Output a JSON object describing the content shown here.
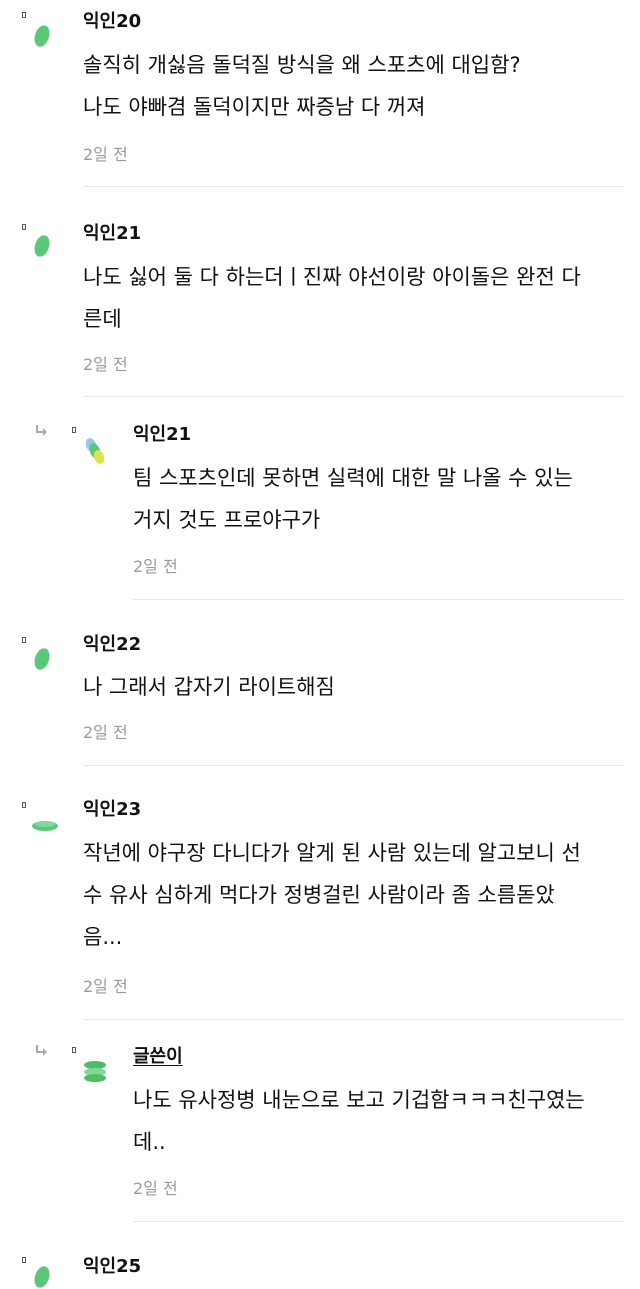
{
  "comments": [
    {
      "author": "익인20",
      "lines": [
        "솔직히 개싫음 돌덕질 방식을 왜 스포츠에 대입함?",
        "나도 야빠겸 돌덕이지만 짜증남 다 꺼져"
      ],
      "time": "2일 전",
      "reply": false,
      "avatar_color": "#5ac779"
    },
    {
      "author": "익인21",
      "lines": [
        "나도 싫어 둘 다 하는더ㅣ진짜 야선이랑 아이돌은 완전 다",
        "른데"
      ],
      "time": "2일 전",
      "reply": false,
      "avatar_color": "#5ac779"
    },
    {
      "author": "익인21",
      "lines": [
        "팀 스포츠인데 못하면 실력에 대한 말 나올 수 있는",
        "거지 것도 프로야구가"
      ],
      "time": "2일 전",
      "reply": true,
      "avatar_color": "#b8d94d"
    },
    {
      "author": "익인22",
      "lines": [
        "나 그래서 갑자기 라이트해짐"
      ],
      "time": "2일 전",
      "reply": false,
      "avatar_color": "#5ac779"
    },
    {
      "author": "익인23",
      "lines": [
        "작년에 야구장 다니다가 알게 된 사람 있는데 알고보니 선",
        "수 유사 심하게 먹다가 정병걸린 사람이라 좀 소름돋았",
        "음..."
      ],
      "time": "2일 전",
      "reply": false,
      "avatar_color": "#5ac779"
    },
    {
      "author": "글쓴이",
      "lines": [
        "나도 유사정병 내눈으로 보고 기겁함ㅋㅋㅋ친구였는",
        "데.."
      ],
      "time": "2일 전",
      "reply": true,
      "avatar_color": "#4cbf63"
    },
    {
      "author": "익인25",
      "lines": [],
      "time": "",
      "reply": false,
      "avatar_color": "#5ac779"
    }
  ],
  "icons": {
    "reply": "reply-arrow-icon",
    "avatar": "avatar-icon",
    "marker": "marker-icon"
  }
}
